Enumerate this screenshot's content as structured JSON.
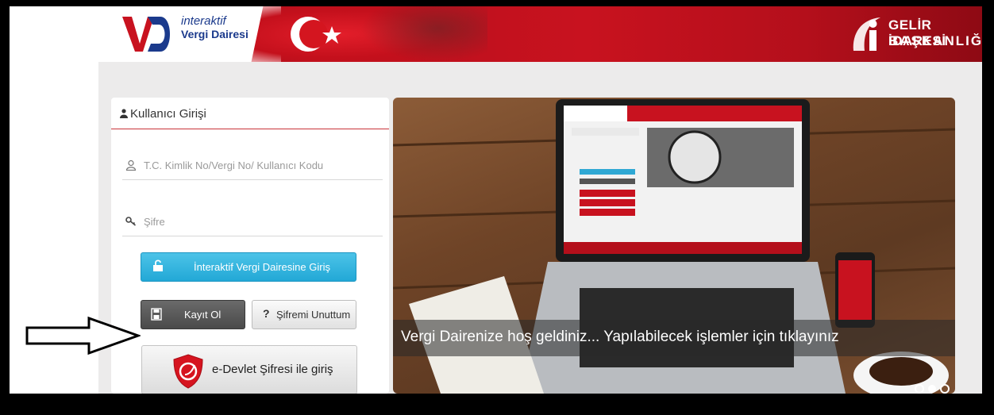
{
  "header": {
    "logo_line1": "interaktif",
    "logo_line2": "Vergi Dairesi",
    "gib_line1": "GELİR İDARESİ",
    "gib_line2": "BAŞKANLIĞI"
  },
  "login": {
    "title": "Kullanıcı Girişi",
    "id_placeholder": "T.C. Kimlik No/Vergi No/ Kullanıcı Kodu",
    "password_placeholder": "Şifre",
    "login_button": "İnteraktif Vergi Dairesine Giriş",
    "register_button": "Kayıt Ol",
    "forgot_button": "Şifremi Unuttum",
    "edevlet_button": "e-Devlet Şifresi ile giriş"
  },
  "hero": {
    "caption": "Vergi Dairenize hoş geldiniz... Yapılabilecek işlemler için tıklayınız"
  },
  "colors": {
    "brand_red": "#c8121f",
    "login_blue": "#22a8d6",
    "register_dark": "#4a4a4a"
  },
  "icons": [
    "user-icon",
    "person-outline-icon",
    "key-icon",
    "unlock-icon",
    "floppy-disk-icon",
    "question-icon",
    "edevlet-shield-icon",
    "arrow-annotation-icon"
  ]
}
